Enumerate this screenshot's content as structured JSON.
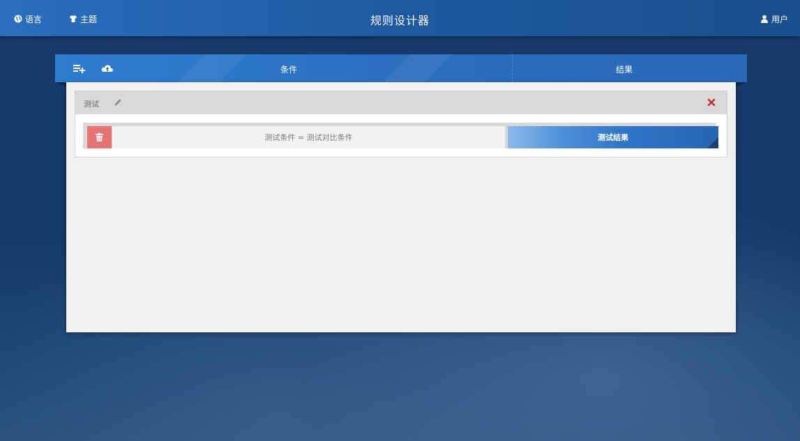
{
  "header": {
    "title": "规则设计器",
    "language_label": "语言",
    "theme_label": "主题",
    "user_label": "用户"
  },
  "toolbar": {
    "condition_label": "条件",
    "result_label": "结果"
  },
  "rule": {
    "name": "测试",
    "rows": [
      {
        "condition": "测试条件 = 测试对比条件",
        "result": "测试结果"
      }
    ]
  },
  "colors": {
    "header_bg": "#2a6fbd",
    "delete_red": "#e57373",
    "close_red": "#c62828",
    "result_blue": "#2f76c6"
  },
  "icons": {
    "language": "globe-icon",
    "theme": "tshirt-icon",
    "user": "user-icon",
    "add": "list-add-icon",
    "upload": "cloud-upload-icon",
    "edit": "pencil-icon",
    "close": "close-icon",
    "delete": "trash-icon"
  }
}
